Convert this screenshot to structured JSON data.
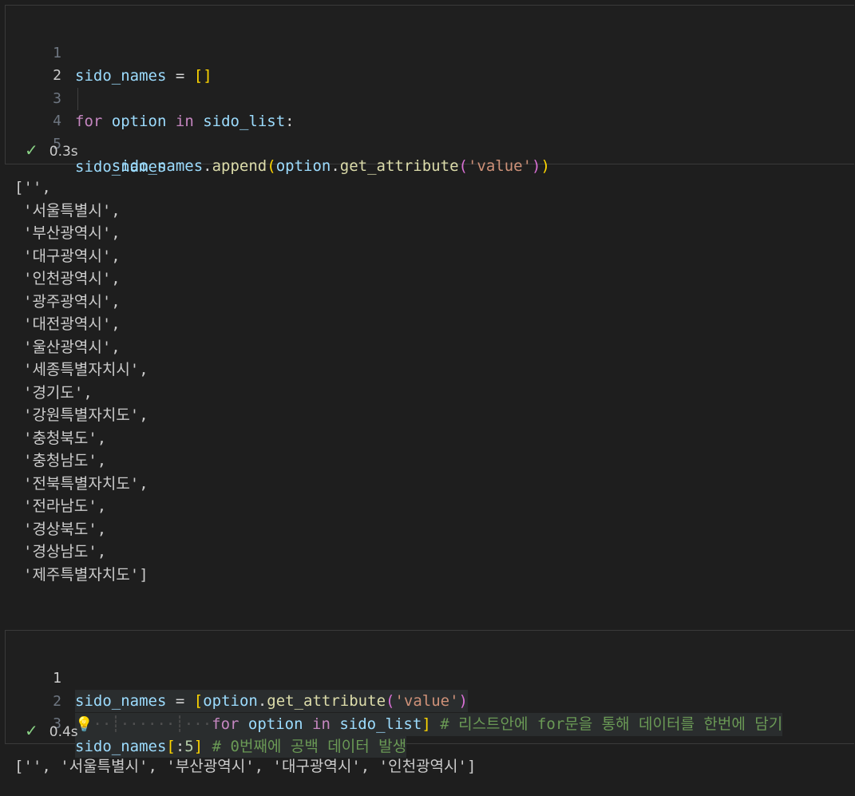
{
  "cell1": {
    "line_numbers": [
      "1",
      "2",
      "3",
      "4",
      "5"
    ],
    "status": {
      "check": "✓",
      "time": "0.3s"
    }
  },
  "output1": {
    "open": "['',",
    "items": [
      "'서울특별시',",
      "'부산광역시',",
      "'대구광역시',",
      "'인천광역시',",
      "'광주광역시',",
      "'대전광역시',",
      "'울산광역시',",
      "'세종특별자치시',",
      "'경기도',",
      "'강원특별자치도',",
      "'충청북도',",
      "'충청남도',",
      "'전북특별자치도',",
      "'전라남도',",
      "'경상북도',",
      "'경상남도',",
      "'제주특별자치도']"
    ]
  },
  "cell2": {
    "line_numbers": [
      "1",
      "2",
      "3"
    ],
    "status": {
      "check": "✓",
      "time": "0.4s"
    }
  },
  "output2": {
    "text": "['', '서울특별시', '부산광역시', '대구광역시', '인천광역시']"
  },
  "colors": {
    "background": "#1e1e1e",
    "keyword": "#c586c0",
    "variable": "#9cdcfe",
    "function": "#dcdcaa",
    "string": "#ce9178",
    "comment": "#6a9955",
    "check": "#89d185"
  }
}
